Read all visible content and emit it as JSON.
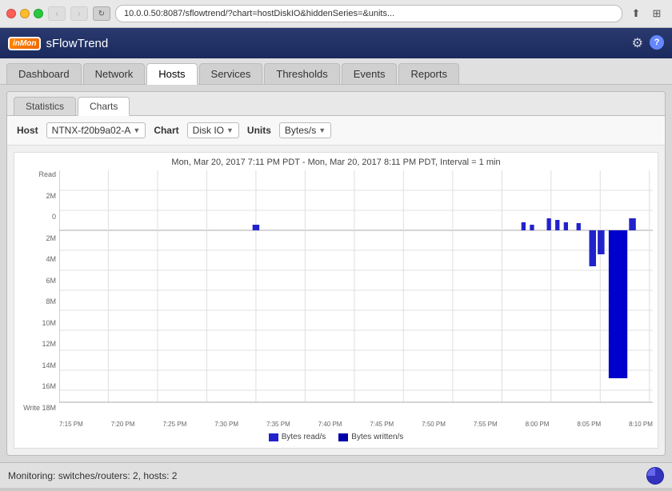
{
  "browser": {
    "url": "10.0.0.50:8087/sflowtrend/?chart=hostDiskIO&hiddenSeries=&units...",
    "nav_back": "‹",
    "nav_forward": "›"
  },
  "app": {
    "logo": "inMon",
    "title": "sFlowTrend"
  },
  "nav": {
    "tabs": [
      {
        "label": "Dashboard",
        "active": false
      },
      {
        "label": "Network",
        "active": false
      },
      {
        "label": "Hosts",
        "active": true
      },
      {
        "label": "Services",
        "active": false
      },
      {
        "label": "Thresholds",
        "active": false
      },
      {
        "label": "Events",
        "active": false
      },
      {
        "label": "Reports",
        "active": false
      }
    ]
  },
  "sub_tabs": [
    {
      "label": "Statistics",
      "active": false
    },
    {
      "label": "Charts",
      "active": true
    }
  ],
  "controls": {
    "host_label": "Host",
    "host_value": "NTNX-f20b9a02-A",
    "chart_label": "Chart",
    "chart_value": "Disk IO",
    "units_label": "Units",
    "units_value": "Bytes/s"
  },
  "chart": {
    "title": "Mon, Mar 20, 2017 7:11 PM PDT - Mon, Mar 20, 2017 8:11 PM PDT, Interval = 1 min",
    "y_labels_top": [
      "2M",
      "0",
      "2M",
      "4M",
      "6M",
      "8M",
      "10M",
      "12M",
      "14M",
      "16M",
      "18M"
    ],
    "x_labels": [
      "7:15 PM",
      "7:20 PM",
      "7:25 PM",
      "7:30 PM",
      "7:35 PM",
      "7:40 PM",
      "7:45 PM",
      "7:50 PM",
      "7:55 PM",
      "8:00 PM",
      "8:05 PM",
      "8:10 PM PM"
    ],
    "read_label": "Read\nBytes/s",
    "write_label": "Write",
    "legend": [
      {
        "color": "#2222cc",
        "label": "Bytes read/s"
      },
      {
        "color": "#0000aa",
        "label": "Bytes written/s"
      }
    ]
  },
  "status": {
    "text": "Monitoring: switches/routers: 2, hosts: 2"
  }
}
